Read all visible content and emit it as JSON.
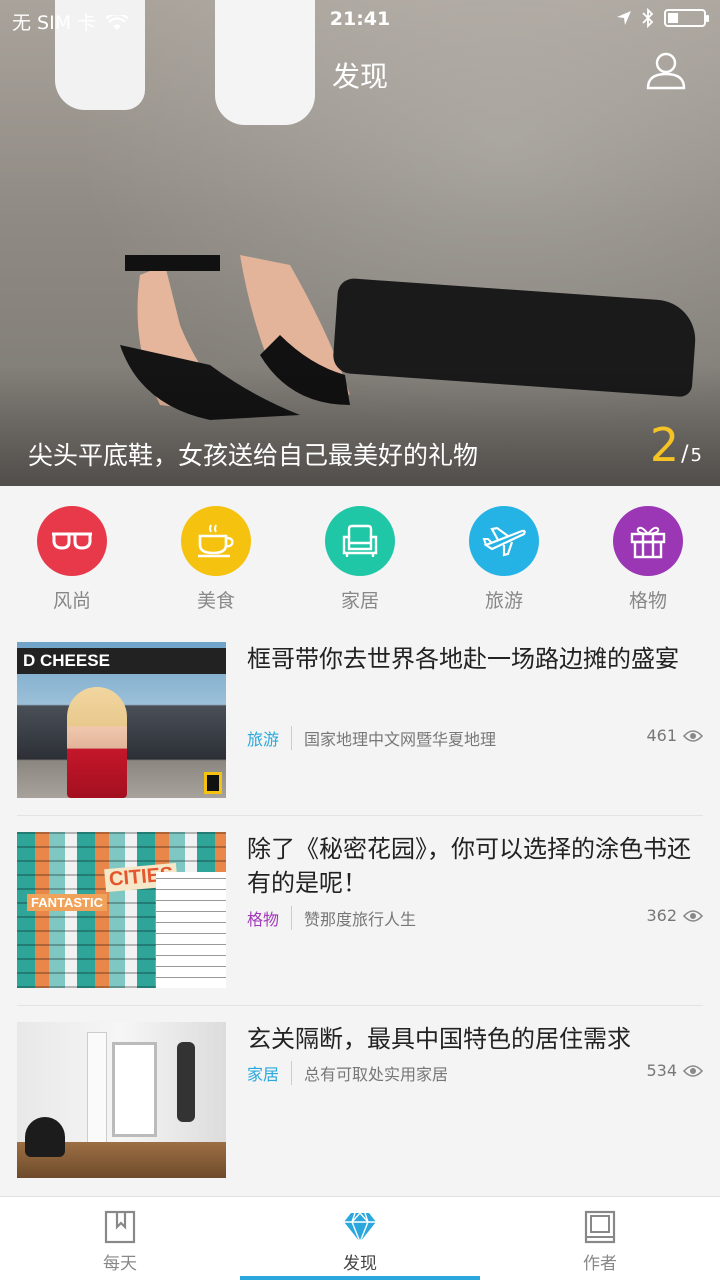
{
  "status_bar": {
    "carrier": "无 SIM 卡",
    "time": "21:41",
    "battery_level": 0.3
  },
  "header": {
    "title": "发现"
  },
  "hero": {
    "caption": "尖头平底鞋，女孩送给自己最美好的礼物",
    "page_current": "2",
    "page_separator": "/",
    "page_total": "5"
  },
  "categories": [
    {
      "label": "风尚",
      "icon": "glasses-icon",
      "color": "#e8394b"
    },
    {
      "label": "美食",
      "icon": "coffee-cup-icon",
      "color": "#f5c210"
    },
    {
      "label": "家居",
      "icon": "armchair-icon",
      "color": "#20c7a6"
    },
    {
      "label": "旅游",
      "icon": "airplane-icon",
      "color": "#25b2e4"
    },
    {
      "label": "格物",
      "icon": "gift-icon",
      "color": "#9b36b4"
    }
  ],
  "articles": [
    {
      "title": "框哥带你去世界各地赴一场路边摊的盛宴",
      "tag": "旅游",
      "tag_color": "#2aa8dd",
      "source": "国家地理中文网暨华夏地理",
      "views": "461",
      "thumb_text": "D CHEESE"
    },
    {
      "title": "除了《秘密花园》，你可以选择的涂色书还有的是呢！",
      "tag": "格物",
      "tag_color": "#a13ab8",
      "source": "赞那度旅行人生",
      "views": "362",
      "thumb_text": "CITIES",
      "thumb_text2": "FANTASTIC"
    },
    {
      "title": "玄关隔断，最具中国特色的居住需求",
      "tag": "家居",
      "tag_color": "#2aa8dd",
      "source": "总有可取处实用家居",
      "views": "534"
    }
  ],
  "tabs": [
    {
      "label": "每天",
      "icon": "bookmark-book-icon"
    },
    {
      "label": "发现",
      "icon": "diamond-icon",
      "active": true
    },
    {
      "label": "作者",
      "icon": "notebook-icon"
    }
  ],
  "colors": {
    "accent": "#2aa8dd",
    "pager_highlight": "#f5c324"
  }
}
